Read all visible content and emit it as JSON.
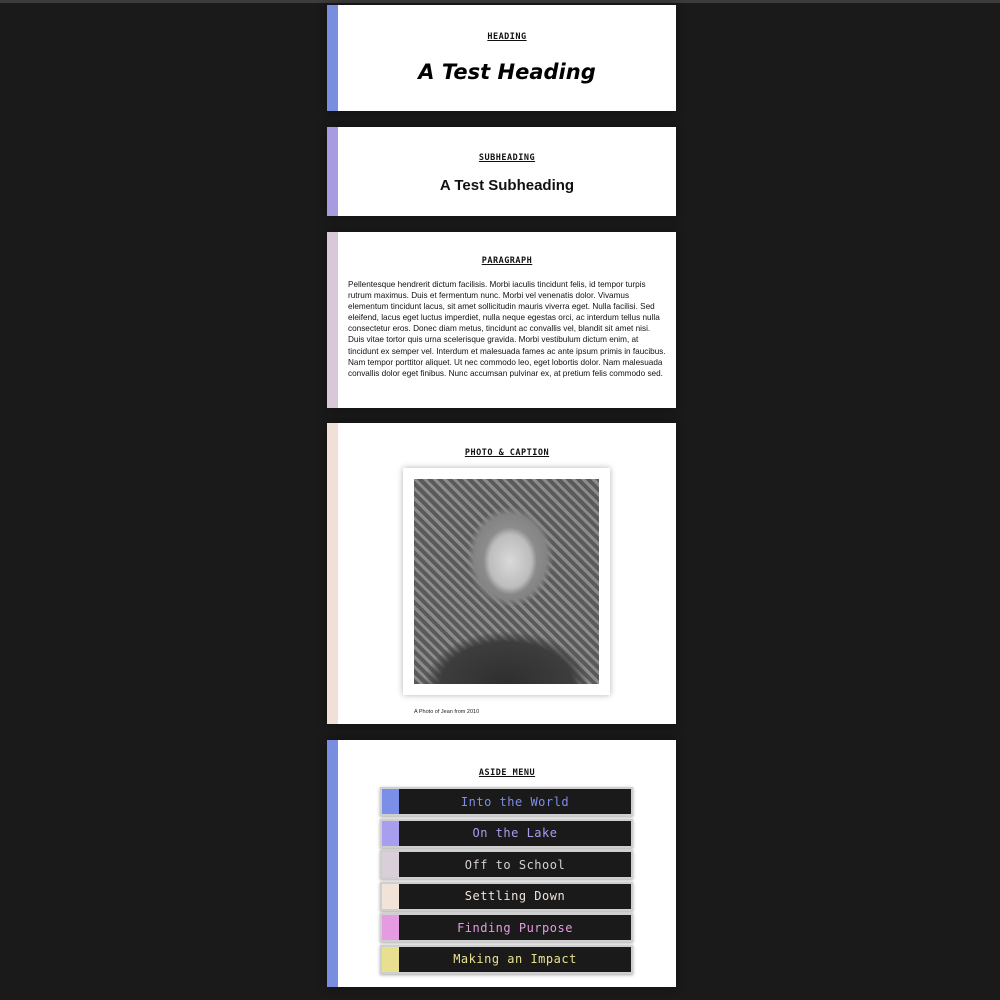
{
  "heading_card": {
    "label": "Heading",
    "text": "A Test Heading",
    "accent": "#7a8ee0"
  },
  "subheading_card": {
    "label": "Subheading",
    "text": "A Test Subheading",
    "accent": "#a99be0"
  },
  "paragraph_card": {
    "label": "Paragraph",
    "text": "Pellentesque hendrerit dictum facilisis. Morbi iaculis tincidunt felis, id tempor turpis rutrum maximus. Duis et fermentum nunc. Morbi vel venenatis dolor. Vivamus elementum tincidunt lacus, sit amet sollicitudin mauris viverra eget. Nulla facilisi. Sed eleifend, lacus eget luctus imperdiet, nulla neque egestas orci, ac interdum tellus nulla consectetur eros. Donec diam metus, tincidunt ac convallis vel, blandit sit amet nisi. Duis vitae tortor quis urna scelerisque gravida. Morbi vestibulum dictum enim, at tincidunt ex semper vel. Interdum et malesuada fames ac ante ipsum primis in faucibus. Nam tempor porttitor aliquet. Ut nec commodo leo, eget lobortis dolor. Nam malesuada convallis dolor eget finibus. Nunc accumsan pulvinar ex, at pretium felis commodo sed.",
    "accent": "#d8c8d8"
  },
  "photo_card": {
    "label": "Photo & Caption",
    "caption": "A Photo of Jean from 2010",
    "accent": "#f0e0d8"
  },
  "aside_card": {
    "label": "Aside Menu",
    "accent": "#7a8ee0",
    "items": [
      {
        "label": "Into the World",
        "color": "#7b8fe8"
      },
      {
        "label": "On the Lake",
        "color": "#a89ef0"
      },
      {
        "label": "Off to School",
        "color": "#d8cfd8"
      },
      {
        "label": "Settling Down",
        "color": "#f2e3d8"
      },
      {
        "label": "Finding Purpose",
        "color": "#e69be0"
      },
      {
        "label": "Making an Impact",
        "color": "#e8e090"
      }
    ]
  }
}
